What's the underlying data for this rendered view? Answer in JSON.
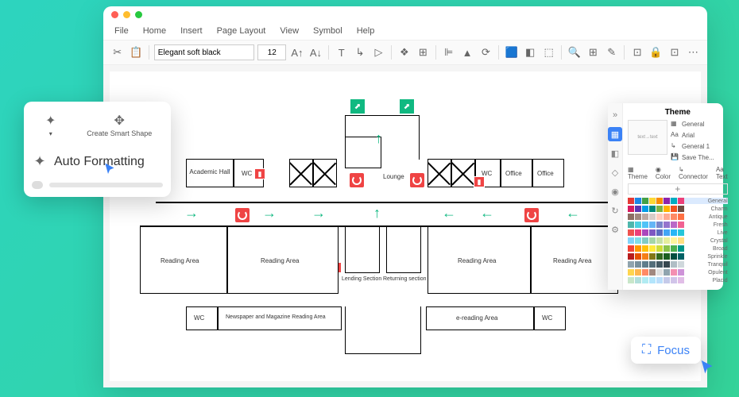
{
  "menubar": [
    "File",
    "Home",
    "Insert",
    "Page Layout",
    "View",
    "Symbol",
    "Help"
  ],
  "toolbar": {
    "font": "Elegant soft black",
    "size": "12"
  },
  "popup": {
    "create_smart": "Create Smart Shape",
    "auto_formatting": "Auto Formatting"
  },
  "theme": {
    "title": "Theme",
    "opts": [
      "General",
      "Arial",
      "General 1",
      "Save The..."
    ],
    "tabs": [
      "Theme",
      "Color",
      "Connector",
      "Text"
    ],
    "swatch_labels": [
      "General",
      "Charm",
      "Antique",
      "Fresh",
      "Live",
      "Crystal",
      "Broad",
      "Sprinkle",
      "Tranquil",
      "Opulent",
      "Placid"
    ],
    "swatch_rows": [
      [
        "#e53935",
        "#1e88e5",
        "#43a047",
        "#fdd835",
        "#fb8c00",
        "#8e24aa",
        "#00acc1",
        "#ec407a"
      ],
      [
        "#d81b60",
        "#5e35b1",
        "#039be5",
        "#00897b",
        "#7cb342",
        "#ffb300",
        "#f4511e",
        "#6d4c41"
      ],
      [
        "#8d6e63",
        "#a1887f",
        "#bcaaa4",
        "#d7ccc8",
        "#ffccbc",
        "#ffab91",
        "#ff8a65",
        "#ff7043"
      ],
      [
        "#4db6ac",
        "#4dd0e1",
        "#4fc3f7",
        "#64b5f6",
        "#7986cb",
        "#9575cd",
        "#ba68c8",
        "#f06292"
      ],
      [
        "#ef5350",
        "#ec407a",
        "#ab47bc",
        "#7e57c2",
        "#5c6bc0",
        "#42a5f5",
        "#29b6f6",
        "#26c6da"
      ],
      [
        "#81d4fa",
        "#80deea",
        "#80cbc4",
        "#a5d6a7",
        "#c5e1a5",
        "#e6ee9c",
        "#fff59d",
        "#ffe082"
      ],
      [
        "#f44336",
        "#ff9800",
        "#ffc107",
        "#ffeb3b",
        "#cddc39",
        "#8bc34a",
        "#4caf50",
        "#009688"
      ],
      [
        "#b71c1c",
        "#e65100",
        "#f57f17",
        "#827717",
        "#33691e",
        "#1b5e20",
        "#004d40",
        "#006064"
      ],
      [
        "#90a4ae",
        "#78909c",
        "#607d8b",
        "#546e7a",
        "#455a64",
        "#37474f",
        "#b0bec5",
        "#cfd8dc"
      ],
      [
        "#ffd54f",
        "#ffb74d",
        "#ff8a65",
        "#a1887f",
        "#e0e0e0",
        "#90a4ae",
        "#f48fb1",
        "#ce93d8"
      ],
      [
        "#c8e6c9",
        "#b2dfdb",
        "#b2ebf2",
        "#b3e5fc",
        "#bbdefb",
        "#c5cae9",
        "#d1c4e9",
        "#e1bee7"
      ]
    ]
  },
  "focus": {
    "label": "Focus"
  },
  "rooms": {
    "academic_hall": "Academic Hall",
    "wc": "WC",
    "office": "Office",
    "lounge": "Lounge",
    "reading_area": "Reading Area",
    "lending": "Lending Section",
    "returning": "Returning section",
    "newspaper": "Newspaper and Magazine Reading Area",
    "ereading": "e-reading Area"
  }
}
